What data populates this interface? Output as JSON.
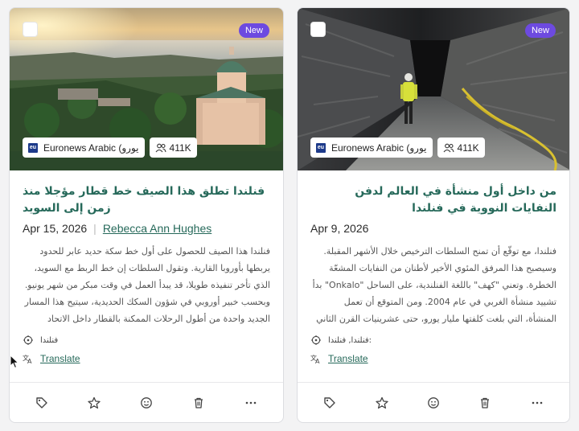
{
  "cards": [
    {
      "badge": "New",
      "source": "Euronews Arabic (يورو",
      "source_icon": "euronews-logo",
      "reach": "411K",
      "title": "فنلندا تطلق هذا الصيف خط قطار مؤجلا منذ زمن إلى السويد",
      "date": "Apr 15, 2026",
      "author": "Rebecca Ann Hughes",
      "snippet": "فنلندا هذا الصيف للحصول على أول خط سكة حديد عابر للحدود يربطها بأوروبا القارية. وتقول السلطات إن خط الربط مع السويد، الذي تأخر تنفيذه طويلا، قد يبدأ العمل في وقت مبكر من شهر يونيو. وبحسب خبير أوروبي في شؤون السكك الحديدية، سيتيح هذا المسار الجديد واحدة من أطول الرحلات الممكنة بالقطار داخل الاتحاد",
      "location": "فنلندا",
      "translate_label": "Translate"
    },
    {
      "badge": "New",
      "source": "Euronews Arabic (يورو",
      "source_icon": "euronews-logo",
      "reach": "411K",
      "title": "من داخل أول منشأة في العالم لدفن النفايات النووية في فنلندا",
      "date": "Apr 9, 2026",
      "author": "",
      "snippet": "فنلندا، مع توقّع أن تمنح السلطات الترخيص خلال الأشهر المقبلة. وسيصبح هذا المرفق المئوي الأخير لأطنان من النفايات المشعّة الخطرة. وتعني \"كهف\" باللغة الفنلندية، على الساحل \"Onkalo\" بدأ تشييد منشأة الغربي في عام 2004. ومن المتوقع أن تعمل المنشأة، التي بلغت كلفتها مليار يورو، حتى عشرينيات القرن الثاني",
      "location": "فنلندا, فنلندا:",
      "translate_label": "Translate"
    }
  ],
  "footer_actions": [
    "tag-icon",
    "star-icon",
    "smiley-icon",
    "trash-icon",
    "more-icon"
  ]
}
